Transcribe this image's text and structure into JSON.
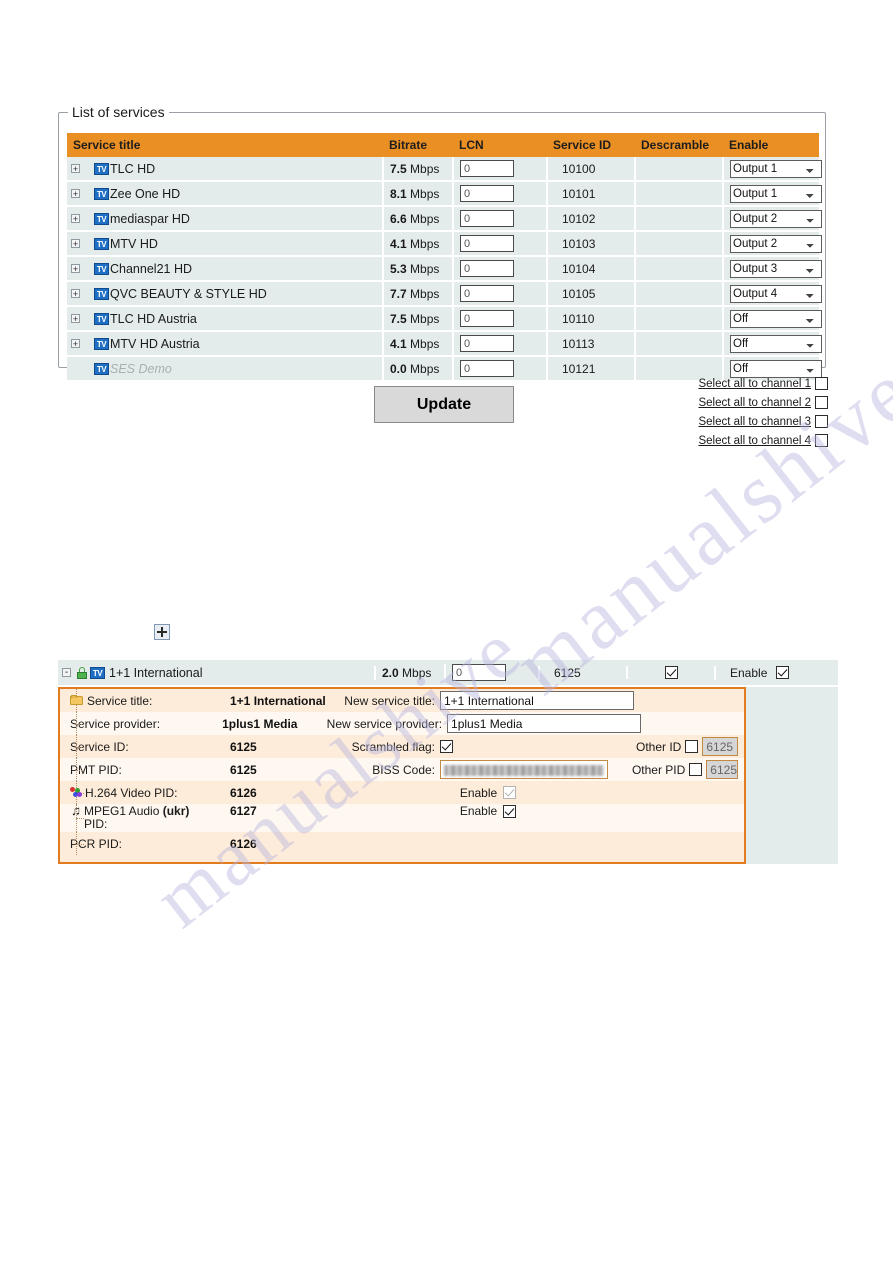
{
  "fieldset": {
    "legend": "List of services"
  },
  "table": {
    "columns": [
      "Service title",
      "Bitrate",
      "LCN",
      "Service ID",
      "Descramble",
      "Enable"
    ],
    "rows": [
      {
        "icon": "tv-icon",
        "title": "TLC HD",
        "bitrate": "7.5",
        "unit": "Mbps",
        "lcn": "0",
        "service_id": "10100",
        "descramble": "",
        "enable": "Output 1",
        "expandable": true,
        "dim": false
      },
      {
        "icon": "tv-icon",
        "title": "Zee One HD",
        "bitrate": "8.1",
        "unit": "Mbps",
        "lcn": "0",
        "service_id": "10101",
        "descramble": "",
        "enable": "Output 1",
        "expandable": true,
        "dim": false
      },
      {
        "icon": "tv-icon",
        "title": "mediaspar HD",
        "bitrate": "6.6",
        "unit": "Mbps",
        "lcn": "0",
        "service_id": "10102",
        "descramble": "",
        "enable": "Output 2",
        "expandable": true,
        "dim": false
      },
      {
        "icon": "tv-icon",
        "title": "MTV HD",
        "bitrate": "4.1",
        "unit": "Mbps",
        "lcn": "0",
        "service_id": "10103",
        "descramble": "",
        "enable": "Output 2",
        "expandable": true,
        "dim": false
      },
      {
        "icon": "tv-icon",
        "title": "Channel21 HD",
        "bitrate": "5.3",
        "unit": "Mbps",
        "lcn": "0",
        "service_id": "10104",
        "descramble": "",
        "enable": "Output 3",
        "expandable": true,
        "dim": false
      },
      {
        "icon": "tv-icon",
        "title": "QVC BEAUTY & STYLE HD",
        "bitrate": "7.7",
        "unit": "Mbps",
        "lcn": "0",
        "service_id": "10105",
        "descramble": "",
        "enable": "Output 4",
        "expandable": true,
        "dim": false
      },
      {
        "icon": "tv-icon",
        "title": "TLC HD Austria",
        "bitrate": "7.5",
        "unit": "Mbps",
        "lcn": "0",
        "service_id": "10110",
        "descramble": "",
        "enable": "Off",
        "expandable": true,
        "dim": false
      },
      {
        "icon": "tv-icon",
        "title": "MTV HD Austria",
        "bitrate": "4.1",
        "unit": "Mbps",
        "lcn": "0",
        "service_id": "10113",
        "descramble": "",
        "enable": "Off",
        "expandable": true,
        "dim": false
      },
      {
        "icon": "tv-icon",
        "title": "SES Demo",
        "bitrate": "0.0",
        "unit": "Mbps",
        "lcn": "0",
        "service_id": "10121",
        "descramble": "",
        "enable": "Off",
        "expandable": false,
        "dim": true
      }
    ],
    "enable_options": [
      "Off",
      "Output 1",
      "Output 2",
      "Output 3",
      "Output 4"
    ]
  },
  "update_button": {
    "label": "Update"
  },
  "select_all": [
    {
      "label": "Select all to channel 1",
      "checked": false
    },
    {
      "label": "Select all to channel 2",
      "checked": false
    },
    {
      "label": "Select all to channel 3",
      "checked": false
    },
    {
      "label": "Select all to channel 4",
      "checked": false
    }
  ],
  "detail": {
    "header": {
      "title": "1+1 International",
      "bitrate": "2.0",
      "unit": "Mbps",
      "lcn": "0",
      "service_id": "6125",
      "descramble_checked": true,
      "enable_label": "Enable",
      "enable_checked": true
    },
    "rows": [
      {
        "label": "Service title:",
        "value": "1+1 International",
        "mid_label": "New service title:",
        "input_value": "1+1 International",
        "icon": "folder-icon"
      },
      {
        "label": "Service provider:",
        "value": "1plus1 Media",
        "mid_label": "New service provider:",
        "input_value": "1plus1 Media",
        "icon": ""
      },
      {
        "label": "Service ID:",
        "value": "6125",
        "mid_label": "Scrambled flag:",
        "checkbox_checked": true,
        "tail_label": "Other ID",
        "tail_checked": false,
        "tail_value": "6125",
        "icon": ""
      },
      {
        "label": "PMT PID:",
        "value": "6125",
        "mid_label": "BISS Code:",
        "biss": true,
        "tail_label": "Other PID",
        "tail_checked": false,
        "tail_value": "6125",
        "icon": ""
      },
      {
        "label": "H.264 Video PID:",
        "value": "6126",
        "mid_label": "Enable",
        "enable_checked": true,
        "enable_disabled": true,
        "icon": "video-icon"
      },
      {
        "label": "MPEG1 Audio (ukr) PID:",
        "label_main": "MPEG1 Audio",
        "label_lang": "(ukr)",
        "label_tail": "PID:",
        "value": "6127",
        "mid_label": "Enable",
        "enable_checked": true,
        "enable_disabled": false,
        "icon": "audio-icon"
      },
      {
        "label": "PCR PID:",
        "value": "6126",
        "mid_label": "",
        "icon": ""
      }
    ]
  },
  "icons": {
    "expand": "+",
    "collapse": "-",
    "tv": "TV",
    "audio_note": "♫",
    "float_plus": "plus-icon"
  },
  "colors": {
    "header_orange": "#ea8f23",
    "row_bg": "#e3ebeb",
    "detail_border": "#e07b1f",
    "detail_bg": "#fdecd9",
    "detail_alt_bg": "#fff8f1",
    "button_bg": "#d9d9d9"
  },
  "watermark": {
    "line1": "manualshive.com",
    "line2": "manualshive"
  }
}
